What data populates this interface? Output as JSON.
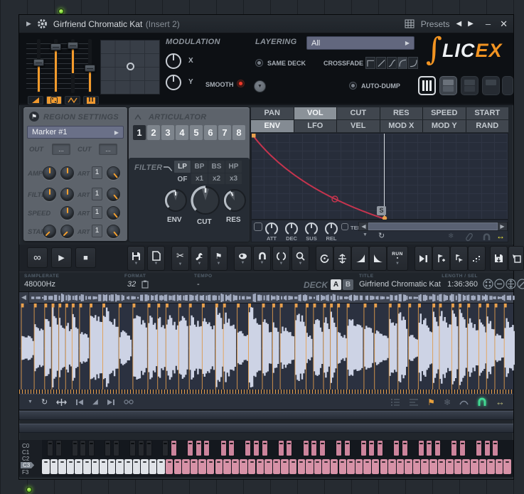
{
  "titlebar": {
    "title": "Girfriend Chromatic Kat",
    "subtitle": "(Insert 2)",
    "presets_label": "Presets"
  },
  "top": {
    "modulation": {
      "title": "MODULATION",
      "x_label": "X",
      "y_label": "Y",
      "smooth_label": "SMOOTH"
    },
    "layering": {
      "title": "LAYERING",
      "selected": "All",
      "same_deck_label": "SAME DECK",
      "crossfade_label": "CROSSFADE"
    },
    "auto_dump_label": "AUTO-DUMP",
    "logo": {
      "swoosh": "∫",
      "lic": "LIC",
      "ex": "EX"
    }
  },
  "region": {
    "title": "REGION SETTINGS",
    "marker": "Marker #1",
    "out_label": "OUT",
    "cut_label": "CUT",
    "dots": "...",
    "rows": [
      {
        "label": "AMP",
        "art": "ART",
        "value": "1"
      },
      {
        "label": "FILTER",
        "art": "ART",
        "value": "1"
      },
      {
        "label": "SPEED",
        "art": "ART",
        "value": "1"
      },
      {
        "label": "START",
        "art": "ART",
        "value": "1"
      }
    ]
  },
  "articulator": {
    "title": "ARTICULATOR",
    "slots": [
      "1",
      "2",
      "3",
      "4",
      "5",
      "6",
      "7",
      "8"
    ],
    "selected_slot": "1",
    "filter": {
      "title": "FILTER",
      "types": [
        "LP",
        "BP",
        "BS",
        "HP"
      ],
      "selected_type": "LP",
      "of_label": "OF",
      "mults": [
        "x1",
        "x2",
        "x3"
      ]
    },
    "knobs": [
      "ENV",
      "CUT",
      "RES"
    ]
  },
  "envelope": {
    "tabs_top": [
      "PAN",
      "VOL",
      "CUT",
      "RES",
      "SPEED",
      "START"
    ],
    "selected_top": "VOL",
    "tabs_bottom": [
      "ENV",
      "LFO",
      "VEL",
      "MOD X",
      "MOD Y",
      "RAND"
    ],
    "selected_bottom": "ENV",
    "adsr": [
      "ATT",
      "DEC",
      "SUS",
      "REL"
    ],
    "tempo_label": "TEMPO",
    "sustain_marker": "S",
    "curve_color": "#c5344e",
    "point_color": "#e9a14e"
  },
  "toolbar": {
    "run_label": "RUN"
  },
  "infobar": {
    "samplerate_label": "SAMPLERATE",
    "samplerate": "48000Hz",
    "format_label": "FORMAT",
    "format": "32",
    "tempo_label": "TEMPO",
    "tempo": "-",
    "deck_label": "DECK",
    "deck_a": "A",
    "deck_b": "B",
    "title_label": "TITLE",
    "title": "Girfriend Chromatic Kat",
    "length_label": "LENGTH / SEL",
    "length": "1:36:360"
  },
  "waveform": {
    "num_slices": 46,
    "wave_color": "#cdd3e5",
    "marker_color": "#e9a14e",
    "overview_color": "#a9b2c8"
  },
  "keyboard": {
    "labels": [
      "C0",
      "C1",
      "C2",
      "C3",
      "F3"
    ],
    "selected_label": "C3",
    "white_total": 57,
    "white_plain": 15,
    "key_colors": {
      "white": "#e0e3e8",
      "pink": "#d792a7",
      "black": "#26292e",
      "black_pink": "#cc849c"
    }
  },
  "icons": {
    "collapse": "▶",
    "prev": "◀",
    "next": "▶",
    "minimize": "–",
    "close": "✕",
    "dropdown": "▼",
    "dropdown_right": "▶",
    "infinity": "∞",
    "play": "▶",
    "stop": "■",
    "scissors": "✂",
    "reload": "↻",
    "snowflake": "❄",
    "h_arrows": "↔",
    "flag": "⚑",
    "ramp": "◢",
    "scroll_left": "◀",
    "scroll_right": "▶"
  },
  "colors": {
    "accent_orange": "#f29422",
    "led_green": "#7ddc35",
    "magnet_green": "#42da93",
    "smooth_led_red": "#ef392b",
    "selected_tab": "#8b9299",
    "pink_keys": "#d792a7"
  }
}
